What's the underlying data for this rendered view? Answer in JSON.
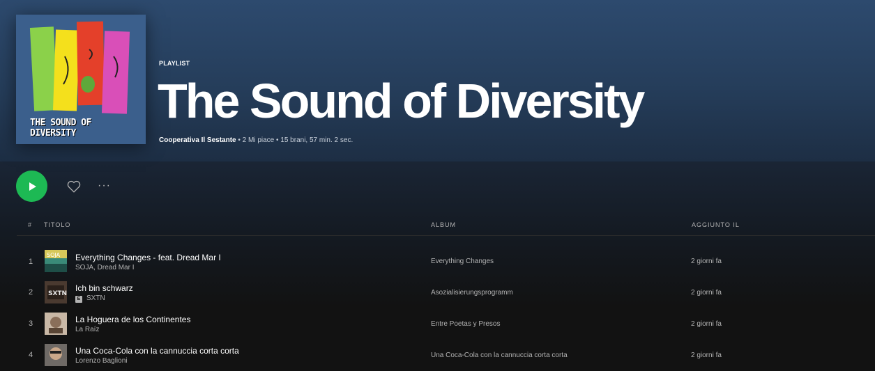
{
  "playlist": {
    "type_label": "PLAYLIST",
    "title": "The Sound of Diversity",
    "owner": "Cooperativa Il Sestante",
    "meta_rest": " • 2 Mi piace • 15 brani, 57 min. 2 sec.",
    "cover_text": "THE SOUND OF DIVERSITY"
  },
  "controls": {
    "play_icon": "play-icon",
    "like_icon": "heart-icon",
    "more_label": "···"
  },
  "table": {
    "headers": {
      "index": "#",
      "title": "TITOLO",
      "album": "ALBUM",
      "added": "AGGIUNTO IL"
    },
    "rows": [
      {
        "index": "1",
        "title": "Everything Changes - feat. Dread Mar I",
        "artist": "SOJA, Dread Mar I",
        "explicit": false,
        "album": "Everything Changes",
        "added": "2 giorni fa"
      },
      {
        "index": "2",
        "title": "Ich bin schwarz",
        "artist": "SXTN",
        "explicit": true,
        "explicit_label": "E",
        "album": "Asozialisierungsprogramm",
        "added": "2 giorni fa"
      },
      {
        "index": "3",
        "title": "La Hoguera de los Continentes",
        "artist": "La Raíz",
        "explicit": false,
        "album": "Entre Poetas y Presos",
        "added": "2 giorni fa"
      },
      {
        "index": "4",
        "title": "Una Coca-Cola con la cannuccia corta corta",
        "artist": "Lorenzo Baglioni",
        "explicit": false,
        "album": "Una Coca-Cola con la cannuccia corta corta",
        "added": "2 giorni fa"
      }
    ]
  },
  "colors": {
    "accent": "#1db954",
    "header": "#2d4a6e",
    "background": "#121212"
  }
}
